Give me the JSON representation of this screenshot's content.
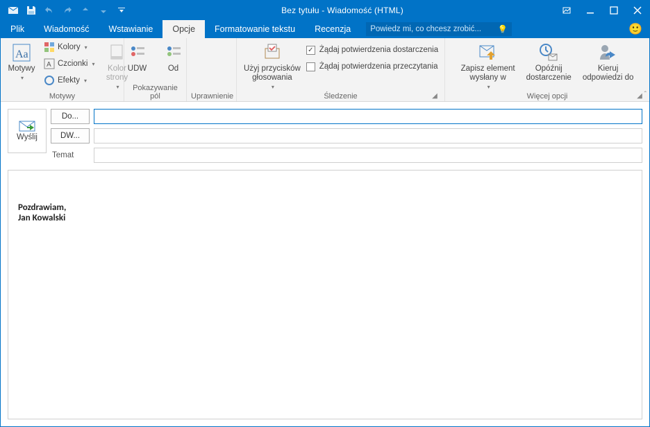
{
  "title": "Bez tytułu - Wiadomość (HTML)",
  "qat": {
    "items": [
      "mail-icon",
      "save-icon",
      "undo-icon",
      "redo-icon",
      "prev-icon",
      "next-icon",
      "more-icon"
    ]
  },
  "tabs": {
    "plik": "Plik",
    "wiadomosc": "Wiadomość",
    "wstawianie": "Wstawianie",
    "opcje": "Opcje",
    "formatowanie": "Formatowanie tekstu",
    "recenzja": "Recenzja"
  },
  "tell_me_placeholder": "Powiedz mi, co chcesz zrobić...",
  "ribbon": {
    "motywy": {
      "label": "Motywy",
      "motywy_btn": "Motywy",
      "kolory": "Kolory",
      "czcionki": "Czcionki",
      "efekty": "Efekty",
      "kolor_strony": "Kolor\nstrony"
    },
    "pokazywanie": {
      "label": "Pokazywanie pól",
      "udw": "UDW",
      "od": "Od"
    },
    "uprawnienie": {
      "label": "Uprawnienie"
    },
    "sledzenie": {
      "label": "Śledzenie",
      "glos": "Użyj przycisków\ngłosowania",
      "dostarczenie": "Żądaj potwierdzenia dostarczenia",
      "przeczytanie": "Żądaj potwierdzenia przeczytania"
    },
    "wiecej": {
      "label": "Więcej opcji",
      "zapisz": "Zapisz element\nwysłany w",
      "opoznij": "Opóźnij\ndostarczenie",
      "kieruj": "Kieruj\nodpowiedzi do"
    }
  },
  "compose": {
    "send": "Wyślij",
    "to": "Do...",
    "cc": "DW...",
    "subject": "Temat"
  },
  "body": {
    "line1": "Pozdrawiam,",
    "line2": "Jan Kowalski"
  }
}
